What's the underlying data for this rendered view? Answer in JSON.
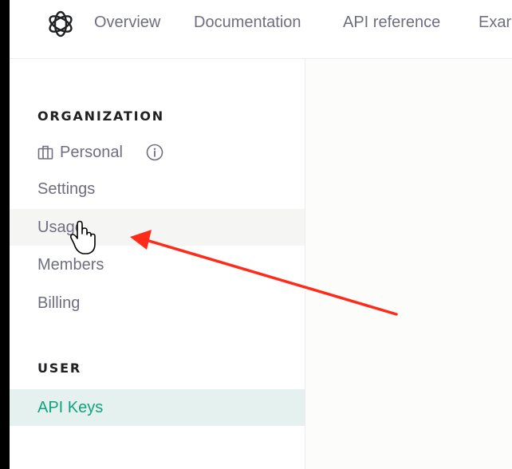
{
  "nav": {
    "logo_icon": "openai-logo-icon",
    "items": [
      "Overview",
      "Documentation",
      "API reference",
      "Exar"
    ]
  },
  "sidebar": {
    "organization": {
      "heading": "ORGANIZATION",
      "selector": {
        "label": "Personal",
        "icon": "building-icon",
        "info_icon": "info-icon"
      },
      "items": [
        "Settings",
        "Usage",
        "Members",
        "Billing"
      ],
      "hovered_item": "Usage"
    },
    "user": {
      "heading": "USER",
      "items": [
        "API Keys"
      ],
      "active_item": "API Keys"
    }
  },
  "annotation": {
    "arrow_color": "#ff2a1a",
    "points_to": "Usage"
  },
  "colors": {
    "accent": "#10a37f",
    "active_bg": "#e4f1ee",
    "hover_bg": "#f5f5f4"
  }
}
